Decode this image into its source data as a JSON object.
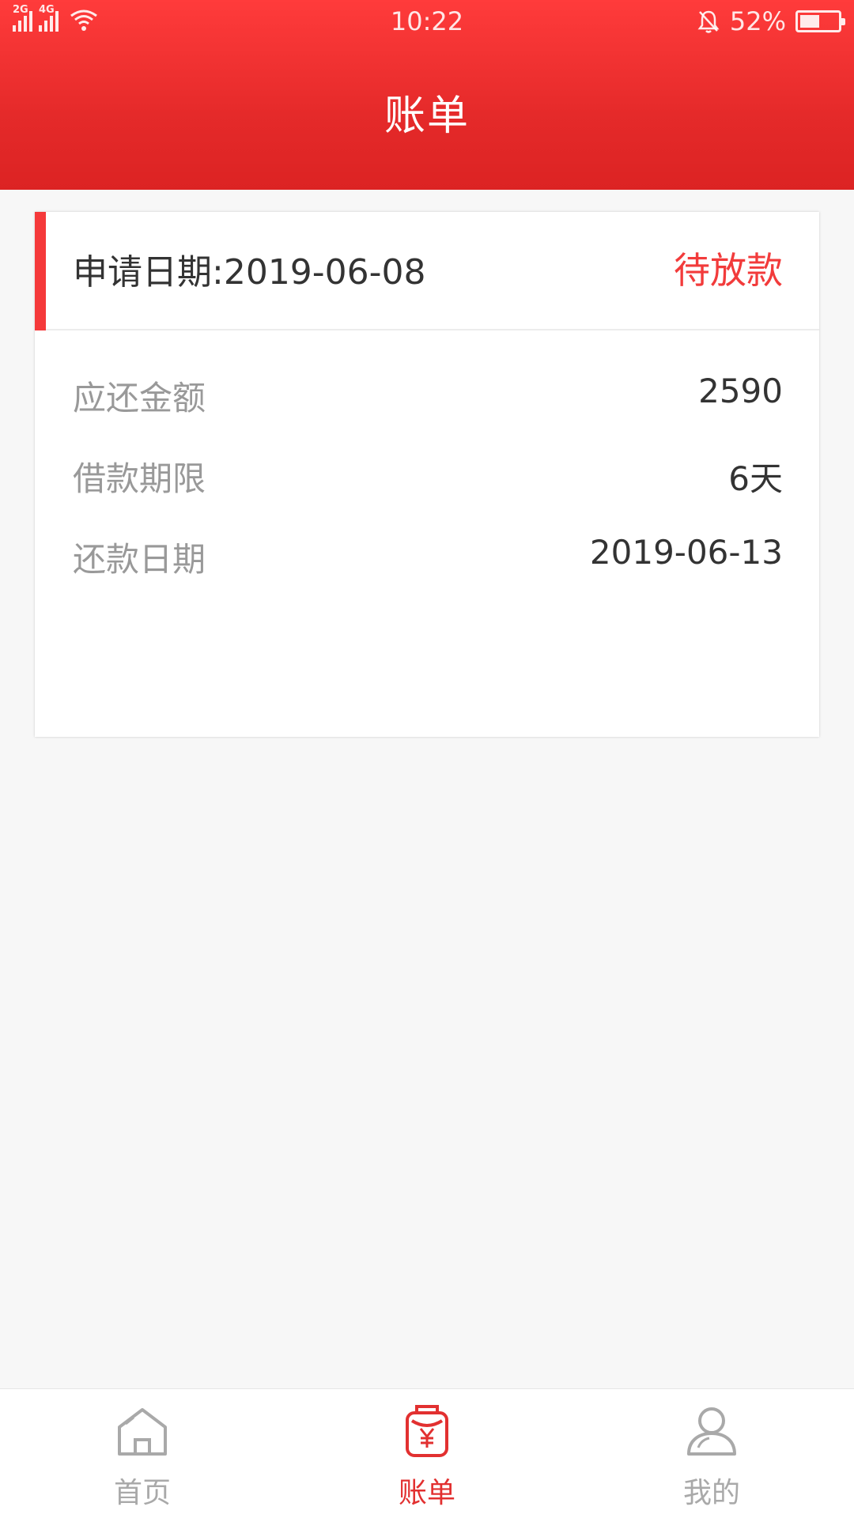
{
  "status_bar": {
    "signal_1_tag": "2G",
    "signal_2_tag": "4G",
    "time": "10:22",
    "battery": "52%",
    "battery_level": 0.52
  },
  "header": {
    "title": "账单"
  },
  "bill": {
    "apply_date_label": "申请日期:",
    "apply_date": "2019-06-08",
    "status": "待放款",
    "rows": [
      {
        "label": "应还金额",
        "value": "2590"
      },
      {
        "label": "借款期限",
        "value": "6天"
      },
      {
        "label": "还款日期",
        "value": "2019-06-13"
      }
    ]
  },
  "tabbar": {
    "tabs": [
      {
        "label": "首页",
        "icon": "home-icon"
      },
      {
        "label": "账单",
        "icon": "bill-icon",
        "active": true
      },
      {
        "label": "我的",
        "icon": "user-icon"
      }
    ]
  },
  "colors": {
    "accent": "#f23b3b",
    "header_top": "#ff3b3b",
    "header_bottom": "#dc2323",
    "inactive_tab": "#a9a9a9"
  }
}
